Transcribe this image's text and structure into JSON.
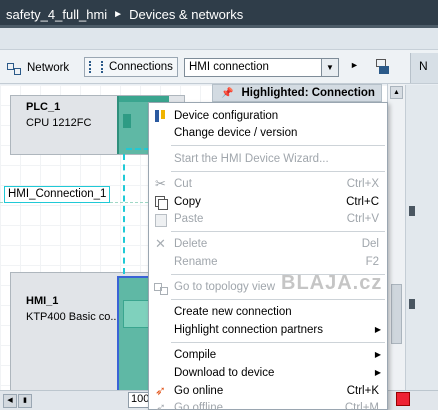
{
  "window": {
    "project": "safety_4_full_hmi",
    "separator": "►",
    "view": "Devices & networks"
  },
  "toolbar": {
    "network_label": "Network",
    "connections_label": "Connections",
    "connection_type": "HMI connection",
    "more": "►",
    "right_tab": "N"
  },
  "highlight": {
    "pin": "📌",
    "label": "Highlighted: Connection"
  },
  "devices": {
    "plc": {
      "name": "PLC_1",
      "type": "CPU 1212FC"
    },
    "hmi": {
      "name": "HMI_1",
      "type": "KTP400 Basic co..."
    }
  },
  "connection": {
    "label": "HMI_Connection_1"
  },
  "context_menu": {
    "device_configuration": "Device configuration",
    "change_device": "Change device / version",
    "start_wizard": "Start the HMI Device Wizard...",
    "cut": "Cut",
    "cut_sc": "Ctrl+X",
    "copy": "Copy",
    "copy_sc": "Ctrl+C",
    "paste": "Paste",
    "paste_sc": "Ctrl+V",
    "delete": "Delete",
    "delete_sc": "Del",
    "rename": "Rename",
    "rename_sc": "F2",
    "topology": "Go to topology view",
    "create_conn": "Create new connection",
    "highlight_partners": "Highlight connection partners",
    "compile": "Compile",
    "download": "Download to device",
    "go_online": "Go online",
    "go_online_sc": "Ctrl+K",
    "go_offline": "Go offline",
    "go_offline_sc": "Ctrl+M",
    "submenu_arrow": "▶"
  },
  "zoom_value": "100",
  "watermark": "BLAJA.cz",
  "colors": {
    "titlebar": "#2f3d49",
    "module": "#5fb8a5",
    "connection": "#20c9d6",
    "selection": "#3a63d6"
  },
  "icons": [
    "network-icon",
    "connections-icon",
    "pin-icon",
    "device-config-icon",
    "cut-icon",
    "copy-icon",
    "paste-icon",
    "delete-icon",
    "topology-icon",
    "go-online-icon",
    "go-offline-icon"
  ]
}
